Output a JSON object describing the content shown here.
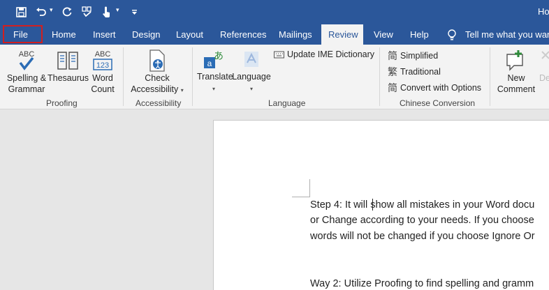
{
  "window": {
    "title_fragment": "Ho"
  },
  "tabs": [
    {
      "id": "file",
      "label": "File"
    },
    {
      "id": "home",
      "label": "Home"
    },
    {
      "id": "insert",
      "label": "Insert"
    },
    {
      "id": "design",
      "label": "Design"
    },
    {
      "id": "layout",
      "label": "Layout"
    },
    {
      "id": "references",
      "label": "References"
    },
    {
      "id": "mailings",
      "label": "Mailings"
    },
    {
      "id": "review",
      "label": "Review",
      "active": true
    },
    {
      "id": "view",
      "label": "View"
    },
    {
      "id": "help",
      "label": "Help"
    }
  ],
  "tell_me": {
    "label": "Tell me what you want"
  },
  "ribbon": {
    "groups": {
      "proofing": "Proofing",
      "accessibility": "Accessibility",
      "language": "Language",
      "chinese": "Chinese Conversion"
    },
    "spelling": {
      "line1": "Spelling &",
      "line2": "Grammar",
      "icon_text": "ABC"
    },
    "thesaurus": {
      "label": "Thesaurus"
    },
    "word_count": {
      "line1": "Word",
      "line2": "Count",
      "icon_top": "ABC",
      "icon_bottom": "123"
    },
    "check_accessibility": {
      "line1": "Check",
      "line2": "Accessibility"
    },
    "translate": {
      "label": "Translate"
    },
    "language": {
      "label": "Language"
    },
    "update_ime": {
      "label": "Update IME Dictionary"
    },
    "simplified": {
      "label": "Simplified"
    },
    "traditional": {
      "label": "Traditional"
    },
    "convert_options": {
      "label": "Convert with Options"
    },
    "new_comment": {
      "line1": "New",
      "line2": "Comment"
    },
    "delete_partial": {
      "label": "De"
    }
  },
  "document": {
    "lines": [
      "Step 4: It will show all mistakes in your Word docu",
      "or Change according to your needs. If you choose",
      "words will not be changed if you choose Ignore Or",
      "Way 2: Utilize Proofing to find spelling and gramm"
    ]
  },
  "colors": {
    "accent": "#2b579a",
    "highlight": "#d21f1f"
  }
}
